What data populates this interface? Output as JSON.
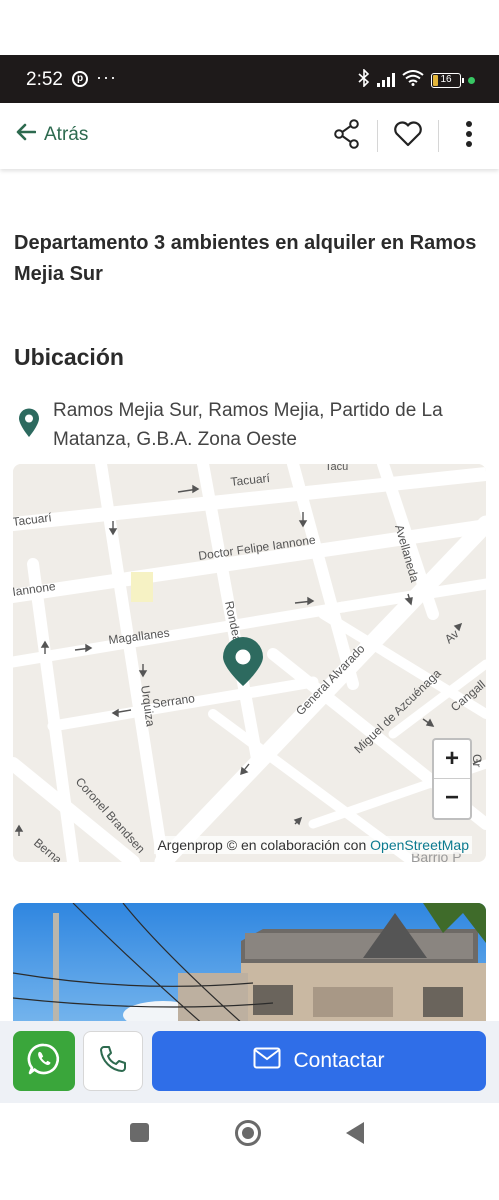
{
  "status_bar": {
    "time": "2:52",
    "notification_icons": [
      "pinterest-icon"
    ],
    "overflow": "···",
    "battery_level": "16",
    "icons": [
      "bluetooth-icon",
      "signal-icon",
      "wifi-icon",
      "battery-icon"
    ]
  },
  "appbar": {
    "back_label": "Atrás",
    "actions": [
      "share-icon",
      "heart-icon",
      "more-vert-icon"
    ]
  },
  "listing": {
    "title": "Departamento 3 ambientes en alquiler en Ramos Mejia Sur"
  },
  "location": {
    "heading": "Ubicación",
    "address": "Ramos Mejia Sur, Ramos Mejia, Partido de La Matanza, G.B.A. Zona Oeste"
  },
  "map": {
    "streets": {
      "tacuari_top": "Tacuarí",
      "tacuari_left": "Tacuarí",
      "iannone_right": "Doctor Felipe Iannone",
      "iannone_left": "Iannone",
      "magallanes": "Magallanes",
      "serrano": "Serrano",
      "urquiza": "Urquiza",
      "rondeau": "Rondeau",
      "general_alvarado": "General Alvarado",
      "avellaneda": "Avellaneda",
      "miguel_azcuenaga": "Miguel de Azcuénaga",
      "coronel_brandsen": "Coronel Brandsen",
      "cangallo": "Cangall",
      "bernardo": "Berna",
      "barrio": "Barrio P",
      "gral": "Gr",
      "avenue_a": "Av"
    },
    "zoom_in": "+",
    "zoom_out": "−",
    "attribution_prefix": "Argenprop © en colaboración con ",
    "attribution_link": "OpenStreetMap",
    "marker_color": "#2d6a5f"
  },
  "actions_bar": {
    "whatsapp": "whatsapp-icon",
    "phone": "phone-icon",
    "contact_label": "Contactar",
    "contact_color": "#2f6ee8",
    "whatsapp_color": "#3aa63b"
  },
  "colors": {
    "accent": "#2d6a4f"
  }
}
